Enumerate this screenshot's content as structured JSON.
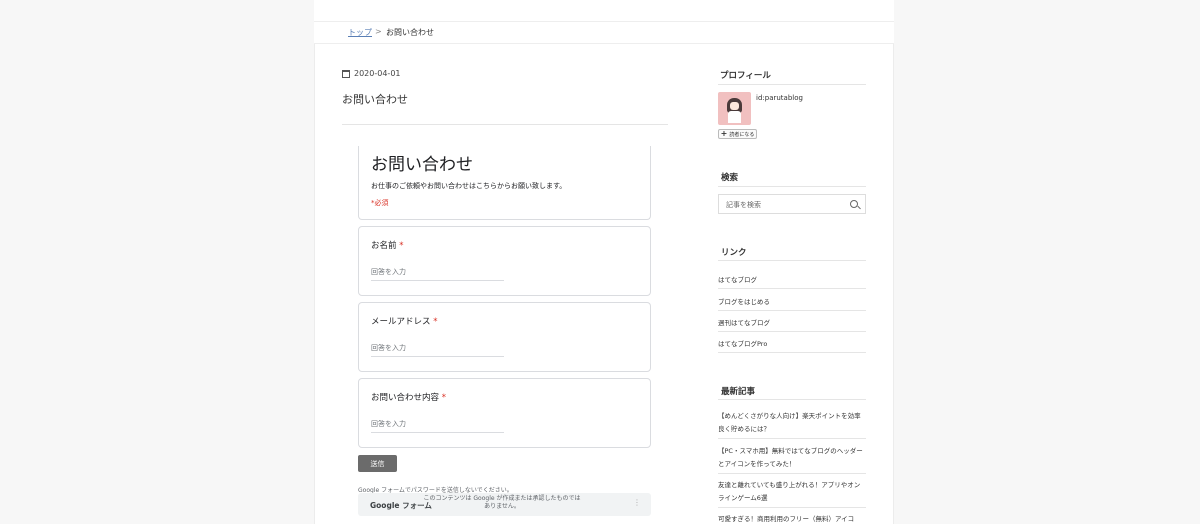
{
  "breadcrumb": {
    "home": "トップ",
    "separator": ">",
    "current": "お問い合わせ"
  },
  "entry": {
    "date": "2020-04-01",
    "title": "お問い合わせ"
  },
  "form": {
    "title": "お問い合わせ",
    "description": "お仕事のご依頼やお問い合わせはこちらからお願い致します。",
    "required_note": "*必須",
    "questions": [
      {
        "label": "お名前",
        "star": "*",
        "placeholder": "回答を入力"
      },
      {
        "label": "メールアドレス",
        "star": "*",
        "placeholder": "回答を入力"
      },
      {
        "label": "お問い合わせ内容",
        "star": "*",
        "placeholder": "回答を入力"
      }
    ],
    "submit_label": "送信",
    "password_warning": "Google フォームでパスワードを送信しないでください。",
    "footer_brand": "Google フォーム",
    "footer_note": "このコンテンツは Google が作成または承認したものではありません。",
    "footer_menu": "⋮"
  },
  "sidebar": {
    "profile": {
      "heading": "プロフィール",
      "id": "id:parutablog",
      "reader_button": "読者になる",
      "reader_plus": "+"
    },
    "search": {
      "heading": "検索",
      "placeholder": "記事を検索"
    },
    "links": {
      "heading": "リンク",
      "items": [
        "はてなブログ",
        "ブログをはじめる",
        "週刊はてなブログ",
        "はてなブログPro"
      ]
    },
    "recent": {
      "heading": "最新記事",
      "items": [
        "【めんどくさがりな人向け】楽天ポイントを効率良く貯めるには？",
        "【PC・スマホ用】無料ではてなブログのヘッダーとアイコンを作ってみた！",
        "友達と離れていても盛り上がれる！アプリやオンラインゲーム6選",
        "可愛すぎる！商用利用のフリー（無料）アイコ"
      ]
    }
  },
  "colors": {
    "accent_link": "#5a7fb5",
    "required_red": "#d93025",
    "submit_bg": "#6b6b6b"
  }
}
